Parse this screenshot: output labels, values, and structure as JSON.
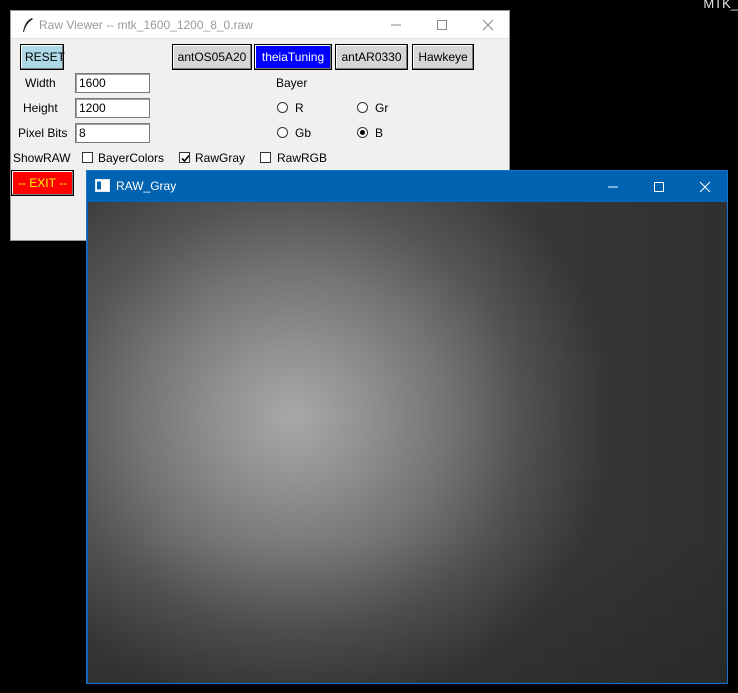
{
  "desktop": {
    "corner_text": "MTK_"
  },
  "raw_viewer": {
    "title": "Raw Viewer -- mtk_1600_1200_8_0.raw",
    "buttons": {
      "reset": "RESET",
      "exit": "-- EXIT --",
      "presets": [
        "antOS05A20",
        "theiaTuning",
        "antAR0330",
        "Hawkeye"
      ]
    },
    "fields": {
      "width_label": "Width",
      "width_value": "1600",
      "height_label": "Height",
      "height_value": "1200",
      "pixel_bits_label": "Pixel Bits",
      "pixel_bits_value": "8"
    },
    "bayer": {
      "label": "Bayer",
      "options": [
        "R",
        "Gr",
        "Gb",
        "B"
      ],
      "selected": "B"
    },
    "show_raw": {
      "label": "ShowRAW",
      "options": [
        {
          "label": "BayerColors",
          "checked": false
        },
        {
          "label": "RawGray",
          "checked": true
        },
        {
          "label": "RawRGB",
          "checked": false
        }
      ]
    },
    "colors": {
      "reset_bg": "#add8e6",
      "active_preset_bg": "#0000ff",
      "exit_bg": "#ff0000",
      "exit_fg": "#ffff00"
    }
  },
  "raw_gray_window": {
    "title": "RAW_Gray",
    "title_bar_color": "#0063b1"
  },
  "icons": [
    "feather-icon",
    "minimize-icon",
    "maximize-icon",
    "close-icon",
    "window-app-icon"
  ]
}
